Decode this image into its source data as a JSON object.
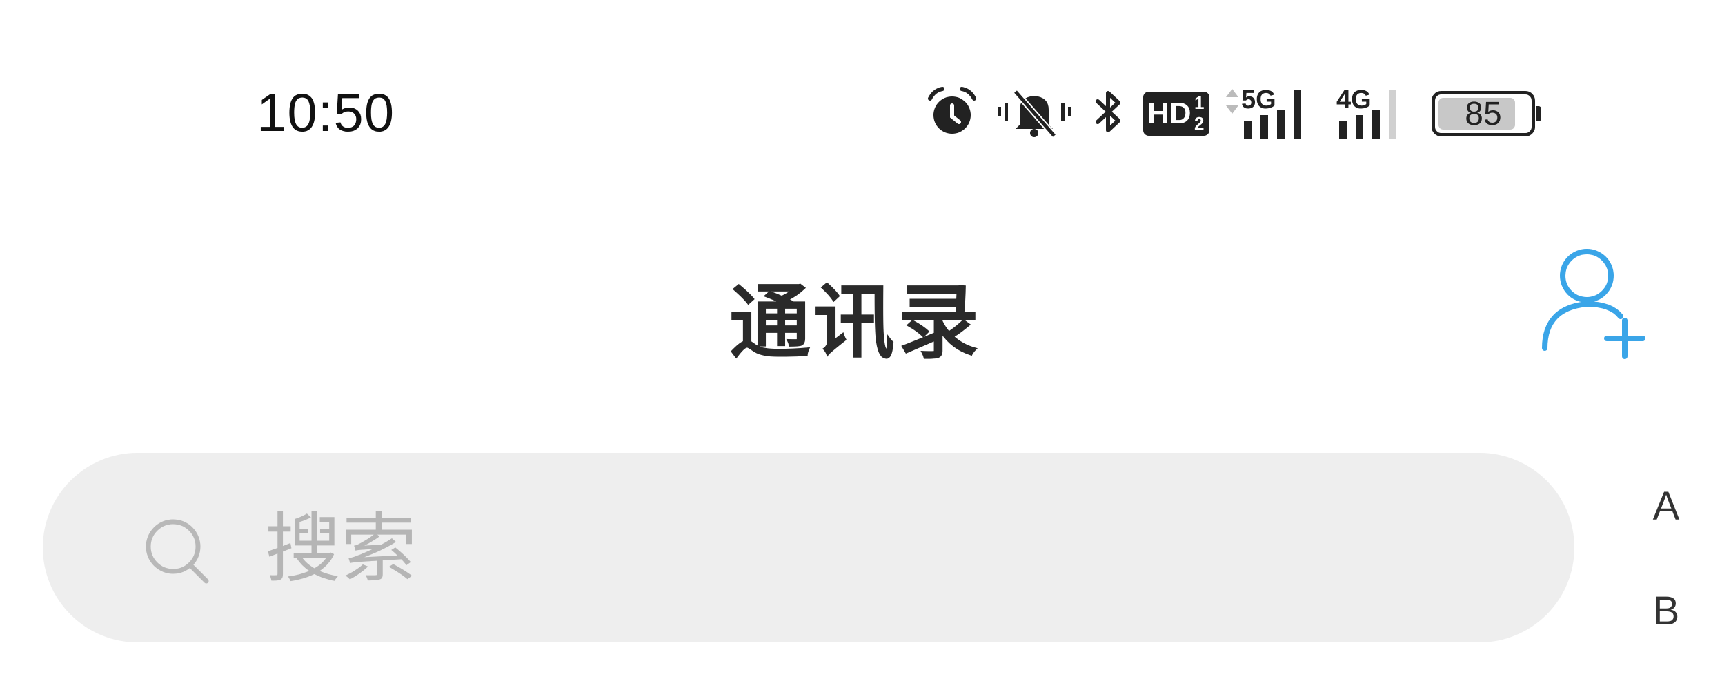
{
  "status_bar": {
    "time": "10:50",
    "icons": [
      "alarm-icon",
      "silent-vibrate-icon",
      "bluetooth-icon",
      "hd-icon",
      "5g-signal-icon",
      "4g-signal-icon",
      "battery-icon"
    ],
    "hd_label": "HD",
    "hd_sub_top": "1",
    "hd_sub_bottom": "2",
    "net1_label": "5G",
    "net2_label": "4G",
    "battery_level": "85",
    "battery_fraction": 0.85
  },
  "header": {
    "title": "通讯录",
    "add_contact_icon": "add-contact-icon",
    "accent_color": "#3aa5e8"
  },
  "search": {
    "placeholder": "搜索",
    "value": ""
  },
  "index": {
    "letters": [
      "A",
      "B"
    ]
  }
}
